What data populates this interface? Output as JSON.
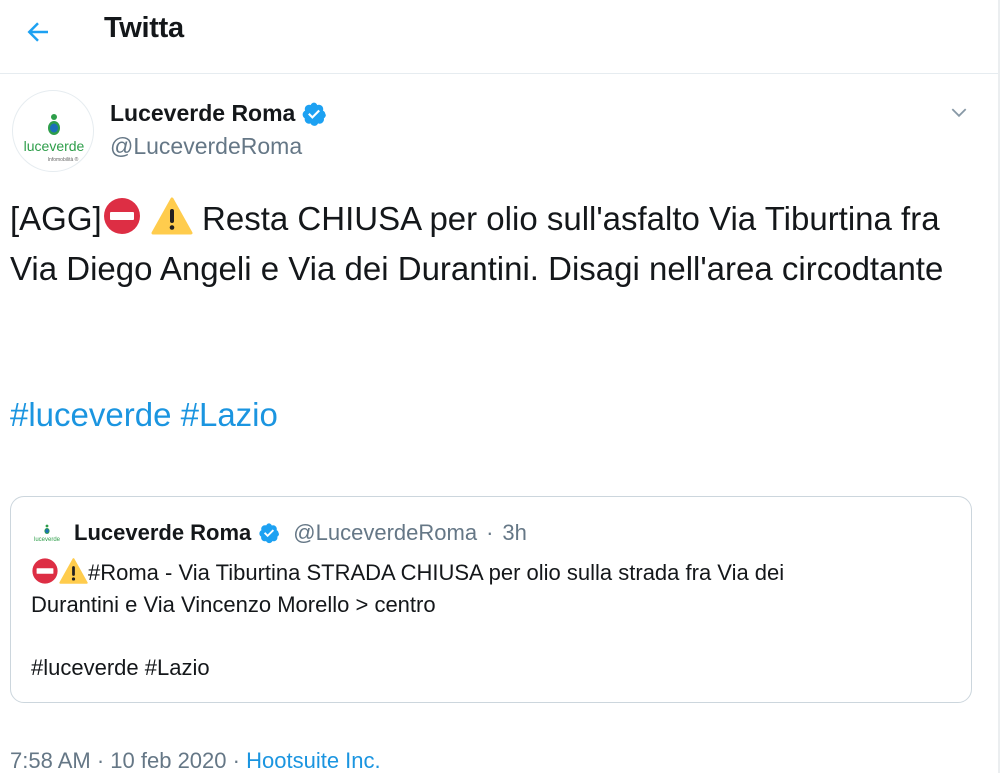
{
  "header": {
    "title": "Twitta"
  },
  "tweet": {
    "author_name": "Luceverde Roma",
    "author_handle": "@LuceverdeRoma",
    "avatar_text": "luceverde",
    "avatar_subtext": "Infomobilità ®",
    "text_prefix": "[AGG]",
    "text_main": "Resta CHIUSA per olio sull'asfalto Via Tiburtina fra Via Diego Angeli e Via dei Durantini. Disagi nell'area circodtante",
    "hashtags": [
      "#luceverde",
      "#Lazio"
    ]
  },
  "quoted": {
    "author_name": "Luceverde Roma",
    "author_handle": "@LuceverdeRoma",
    "separator": "·",
    "time": "3h",
    "text_line1": "#Roma - Via Tiburtina STRADA CHIUSA per olio sulla strada fra Via dei",
    "text_line2": "Durantini e Via Vincenzo Morello > centro",
    "hashtags": "#luceverde #Lazio"
  },
  "footer": {
    "time": "7:58 AM",
    "separator": "·",
    "date": "10 feb 2020",
    "source": "Hootsuite Inc."
  },
  "colors": {
    "link": "#1b95e0",
    "verified": "#1da1f2",
    "brand_green": "#2e9e4a",
    "text": "#14171a",
    "muted": "#657786"
  },
  "icons": [
    "back-arrow-icon",
    "verified-badge-icon",
    "chevron-down-icon",
    "no-entry-icon",
    "warning-icon"
  ]
}
